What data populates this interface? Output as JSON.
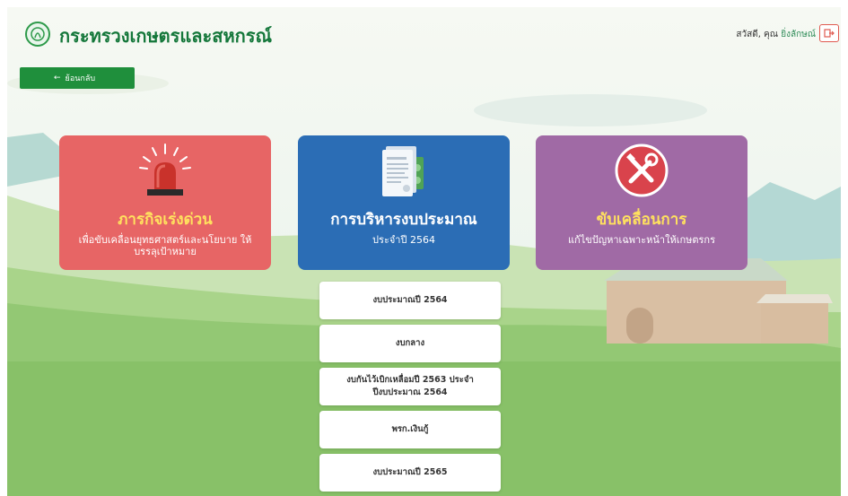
{
  "header": {
    "ministry_name": "กระทรวงเกษตรและสหกรณ์",
    "greeting": "สวัสดี, คุณ",
    "user_name": "ยิ่งลักษณ์"
  },
  "back_button": {
    "label": "ย้อนกลับ"
  },
  "cards": [
    {
      "title": "ภารกิจเร่งด่วน",
      "subtitle": "เพื่อขับเคลื่อนยุทธศาสตร์และนโยบาย ให้บรรลุเป้าหมาย",
      "icon": "siren-icon",
      "color": "#e76565"
    },
    {
      "title": "การบริหารงบประมาณ",
      "subtitle": "ประจำปี 2564",
      "icon": "budget-document-icon",
      "color": "#2b6db5"
    },
    {
      "title": "ขับเคลื่อนการ",
      "subtitle": "แก้ไขปัญหาเฉพาะหน้าให้เกษตรกร",
      "icon": "tools-icon",
      "color": "#a06aa5"
    }
  ],
  "budget_menu": [
    {
      "label": "งบประมาณปี 2564"
    },
    {
      "label": "งบกลาง"
    },
    {
      "label": "งบกันไว้เบิกเหลื่อมปี 2563 ประจำปีงบประมาณ 2564"
    },
    {
      "label": "พรก.เงินกู้"
    },
    {
      "label": "งบประมาณปี 2565"
    }
  ],
  "colors": {
    "brand_green": "#1f8f3c",
    "logout_red": "#e05a50"
  }
}
